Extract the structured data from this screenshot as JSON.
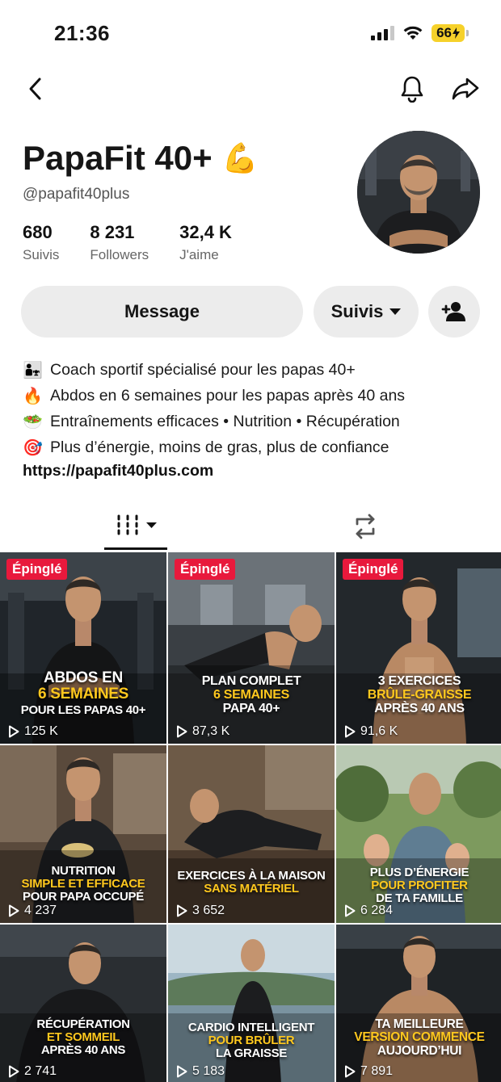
{
  "status": {
    "time": "21:36",
    "battery": "66"
  },
  "profile": {
    "name": "PapaFit 40+",
    "emoji": "💪",
    "handle": "@papafit40plus",
    "stats": [
      {
        "value": "680",
        "label": "Suivis"
      },
      {
        "value": "8 231",
        "label": "Followers"
      },
      {
        "value": "32,4 K",
        "label": "J'aime"
      }
    ]
  },
  "actions": {
    "message": "Message",
    "follow": "Suivis"
  },
  "bio": {
    "lines": [
      {
        "emoji": "👨‍👧",
        "text": "Coach sportif spécialisé pour les papas 40+"
      },
      {
        "emoji": "🔥",
        "text": "Abdos en 6 semaines pour les papas après 40 ans"
      },
      {
        "emoji": "🥗",
        "text": "Entraînements efficaces • Nutrition • Récupération"
      },
      {
        "emoji": "🎯",
        "text": "Plus d’énergie, moins de gras, plus de confiance"
      }
    ],
    "link": "https://papafit40plus.com"
  },
  "videos": [
    {
      "pinned": "Épinglé",
      "l1": "ABDOS EN",
      "l2": "6 SEMAINES",
      "l3": "POUR LES PAPAS 40+",
      "views": "125 K"
    },
    {
      "pinned": "Épinglé",
      "l1": "PLAN COMPLET",
      "l2": "6 SEMAINES",
      "l3": "PAPA 40+",
      "views": "87,3 K"
    },
    {
      "pinned": "Épinglé",
      "l1": "3 EXERCICES",
      "l2": "BRÛLE-GRAISSE",
      "l3": "APRÈS 40 ANS",
      "views": "91,6 K"
    },
    {
      "pinned": "",
      "l1": "NUTRITION",
      "l2": "SIMPLE ET EFFICACE",
      "l3": "POUR PAPA OCCUPÉ",
      "views": "4 237"
    },
    {
      "pinned": "",
      "l1": "EXERCICES À LA MAISON",
      "l2": "SANS MATÉRIEL",
      "l3": "",
      "views": "3 652"
    },
    {
      "pinned": "",
      "l1": "PLUS D’ÉNERGIE",
      "l2": "POUR PROFITER",
      "l3": "DE TA FAMILLE",
      "views": "6 284"
    },
    {
      "pinned": "",
      "l1": "RÉCUPÉRATION",
      "l2": "ET SOMMEIL",
      "l3": "APRÈS 40 ANS",
      "views": "2 741"
    },
    {
      "pinned": "",
      "l1": "CARDIO INTELLIGENT",
      "l2": "POUR BRÛLER",
      "l3": "LA GRAISSE",
      "views": "5 183"
    },
    {
      "pinned": "",
      "l1": "TA MEILLEURE",
      "l2": "VERSION COMMENCE",
      "l3": "AUJOURD’HUI",
      "views": "7 891"
    }
  ],
  "colors": {
    "pinned": "#e8193c",
    "caption_accent": "#ffc81e",
    "button_bg": "#ececec",
    "battery": "#f6d12a"
  }
}
